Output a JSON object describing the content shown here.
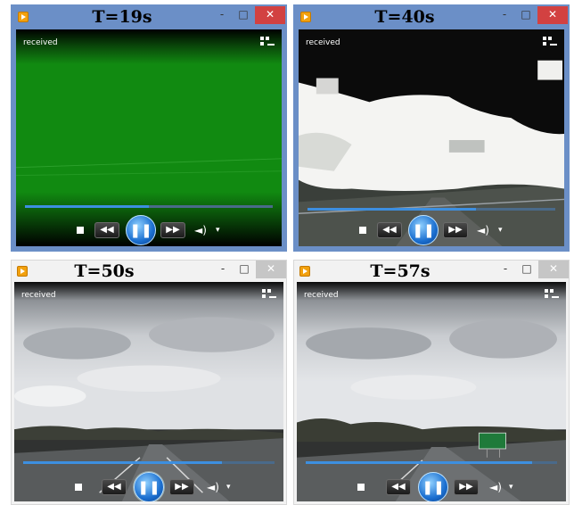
{
  "players": [
    {
      "title": "T=19s",
      "status": "received",
      "progress": 0.5,
      "window_controls": {
        "minimize": "-",
        "maximize": "□",
        "close": "✕"
      }
    },
    {
      "title": "T=40s",
      "status": "received",
      "progress": 0.68,
      "window_controls": {
        "minimize": "-",
        "maximize": "□",
        "close": "✕"
      }
    },
    {
      "title": "T=50s",
      "status": "received",
      "progress": 0.79,
      "window_controls": {
        "minimize": "-",
        "maximize": "□",
        "close": "✕"
      }
    },
    {
      "title": "T=57s",
      "status": "received",
      "progress": 0.9,
      "window_controls": {
        "minimize": "-",
        "maximize": "□",
        "close": "✕"
      }
    }
  ],
  "controls": {
    "stop": "■",
    "rewind": "◀◀",
    "pause": "❚❚",
    "forward": "▶▶",
    "volume": "◄)",
    "volume_menu": "▾"
  },
  "icons": {
    "app": "media-player-icon",
    "switch": "switch-to-library-icon"
  },
  "colors": {
    "accent": "#3d8fe0",
    "close_active": "#d24141",
    "green_frame": "#118a11"
  }
}
